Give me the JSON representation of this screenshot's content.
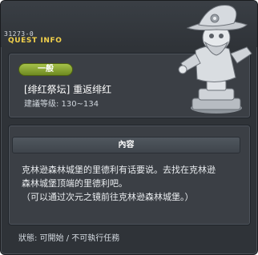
{
  "window": {
    "quest_id": "31273-0",
    "title": "QUEST INFO"
  },
  "quest": {
    "category": "一般",
    "name": "[绯红祭坛] 重返绯红",
    "level_requirement": "建議等级: 130~134"
  },
  "content": {
    "header": "內容",
    "lines": [
      "克林逊森林城堡的里德利有话要说。去找在克林逊",
      "森林城堡顶端的里德利吧。",
      "（可以通过次元之镜前往克林逊森林城堡。）"
    ]
  },
  "status": "狀態: 可開始 / 不可執行任務",
  "colors": {
    "window_bg": "#2f3338",
    "panel_bg": "#3b3f45",
    "title_accent": "#f2d14b",
    "category_badge": "#8aa636"
  },
  "icons": {
    "npc_portrait": "statue-icon"
  }
}
